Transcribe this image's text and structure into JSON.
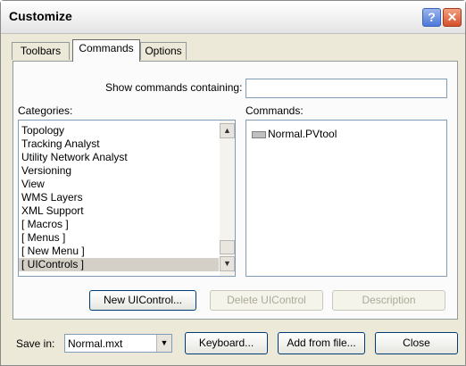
{
  "window": {
    "title": "Customize",
    "help_glyph": "?",
    "close_glyph": "✕"
  },
  "tabs": [
    {
      "label": "Toolbars"
    },
    {
      "label": "Commands"
    },
    {
      "label": "Options"
    }
  ],
  "search": {
    "label": "Show commands containing:",
    "value": ""
  },
  "categories": {
    "label": "Categories:",
    "items": [
      {
        "label": "Topology"
      },
      {
        "label": "Tracking Analyst"
      },
      {
        "label": "Utility Network Analyst"
      },
      {
        "label": "Versioning"
      },
      {
        "label": "View"
      },
      {
        "label": "WMS Layers"
      },
      {
        "label": "XML Support"
      },
      {
        "label": "[ Macros ]"
      },
      {
        "label": "[ Menus ]"
      },
      {
        "label": "[ New Menu ]"
      },
      {
        "label": "[ UIControls ]"
      }
    ],
    "selected": "[ UIControls ]",
    "scroll_up_glyph": "▲",
    "scroll_down_glyph": "▼"
  },
  "commands": {
    "label": "Commands:",
    "items": [
      {
        "label": "Normal.PVtool"
      }
    ]
  },
  "buttons": {
    "new_uicontrol": "New UIControl...",
    "delete_uicontrol": "Delete UIControl",
    "description": "Description"
  },
  "footer": {
    "save_in_label": "Save in:",
    "save_in_value": "Normal.mxt",
    "dropdown_glyph": "▼",
    "keyboard": "Keyboard...",
    "add_from_file": "Add from file...",
    "close": "Close"
  }
}
